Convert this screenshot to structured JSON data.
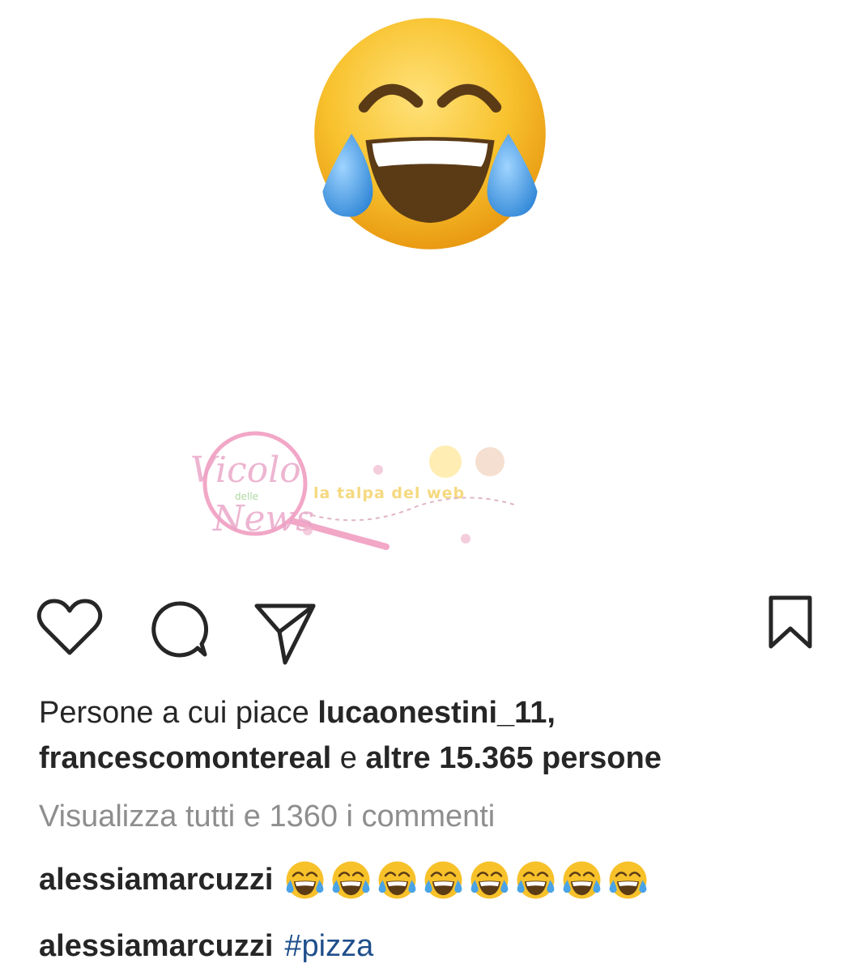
{
  "post": {
    "image_icon": "face-with-tears-of-joy-icon",
    "watermark_text": "Vicolo delle News",
    "watermark_sub": "la talpa del web"
  },
  "actions": {
    "like_icon": "heart-icon",
    "comment_icon": "comment-bubble-icon",
    "share_icon": "paper-plane-icon",
    "save_icon": "bookmark-icon"
  },
  "likes": {
    "prefix": "Persone a cui piace ",
    "user1": "lucaonestini_11",
    "sep": ",",
    "user2": "francescomontereal",
    "joiner": " e ",
    "others": "altre 15.365 persone"
  },
  "comments": {
    "view_all": "Visualizza tutti e 1360 i commenti",
    "items": [
      {
        "user": "alessiamarcuzzi",
        "emoji_icon": "face-with-tears-of-joy-icon",
        "emoji_count": 8
      },
      {
        "user": "alessiamarcuzzi",
        "hashtag": "#pizza"
      }
    ]
  },
  "colors": {
    "text": "#262626",
    "muted": "#8e8e8e",
    "hashtag": "#1f4f8b",
    "emoji_face": "#f7c12a",
    "emoji_tear": "#4aa3e6"
  }
}
